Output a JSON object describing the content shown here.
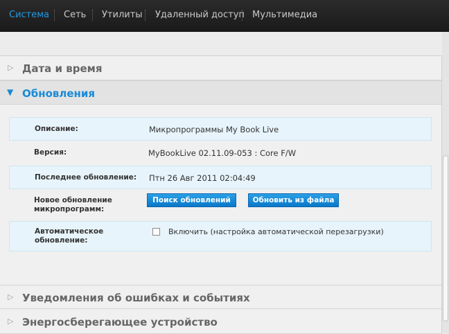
{
  "nav": {
    "tabs": [
      "Система",
      "Сеть",
      "Утилиты",
      "Удаленный доступ",
      "Мультимедиа"
    ]
  },
  "sections": {
    "datetime": "Дата и время",
    "updates": "Обновления",
    "notifications": "Уведомления об ошибках и событиях",
    "power": "Энергосберегающее устройство"
  },
  "updates": {
    "description_label": "Описание:",
    "description_value": "Микропрограммы My Book Live",
    "version_label": "Версия:",
    "version_value": "MyBookLive 02.11.09-053 : Core F/W",
    "last_update_label": "Последнее обновление:",
    "last_update_value": "Птн 26 Авг 2011 02:04:49",
    "new_update_label_1": "Новое обновление",
    "new_update_label_2": "микропрограмм:",
    "check_button": "Поиск обновлений",
    "file_button": "Обновить из файла",
    "auto_label_1": "Автоматическое",
    "auto_label_2": "обновление:",
    "auto_checkbox_label": "Включить (настройка автоматической перезагрузки)",
    "auto_checked": false
  },
  "colors": {
    "accent": "#1a8ad6",
    "button": "#0a78c8",
    "row_shade": "#e7f4fb"
  }
}
